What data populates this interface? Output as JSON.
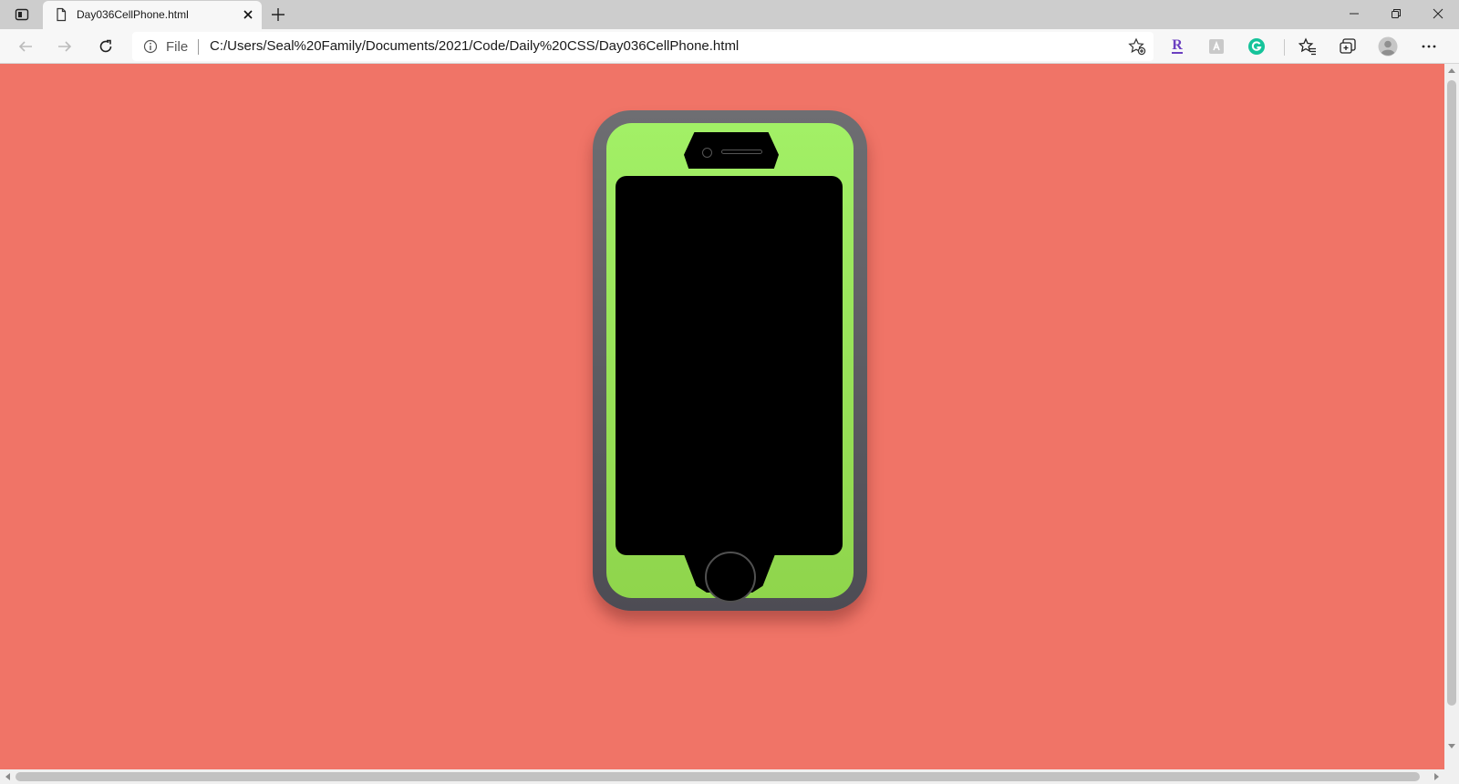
{
  "browser": {
    "tab": {
      "title": "Day036CellPhone.html"
    },
    "address": {
      "scheme_label": "File",
      "url": "C:/Users/Seal%20Family/Documents/2021/Code/Daily%20CSS/Day036CellPhone.html"
    },
    "extensions": {
      "r_ext_label": "R"
    }
  },
  "page": {
    "background_color": "#f07467",
    "phone": {
      "case_color": "#5c5b62",
      "face_color": "#9ce45e",
      "screen_color": "#000000"
    }
  },
  "icons": [
    "tab-actions-icon",
    "page-icon",
    "close-icon",
    "plus-icon",
    "minimize-icon",
    "restore-icon",
    "window-close-icon",
    "back-arrow-icon",
    "forward-arrow-icon",
    "refresh-icon",
    "info-icon",
    "add-favorite-icon",
    "r-extension-icon",
    "extension-icon",
    "grammarly-icon",
    "favorites-icon",
    "collections-icon",
    "profile-icon",
    "more-icon"
  ]
}
